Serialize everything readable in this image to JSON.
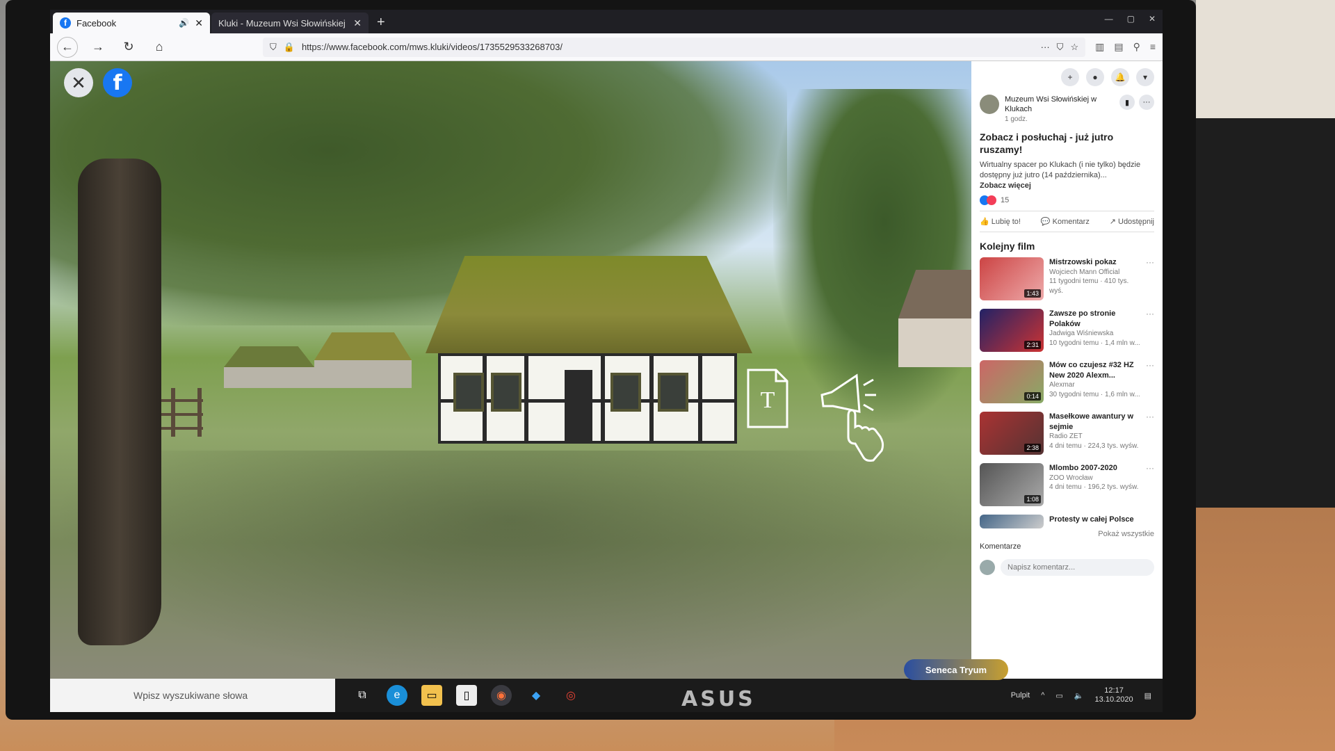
{
  "browser": {
    "tabs": [
      {
        "title": "Facebook",
        "active": true,
        "audio": true
      },
      {
        "title": "Kluki - Muzeum Wsi Słowińskiej w",
        "active": false
      }
    ],
    "url": "https://www.facebook.com/mws.kluki/videos/1735529533268703/"
  },
  "video": {
    "overlay_text_icon": "T"
  },
  "post": {
    "author": "Muzeum Wsi Słowińskiej w Klukach",
    "time": "1 godz.",
    "title": "Zobacz i posłuchaj - już jutro ruszamy!",
    "description": "Wirtualny spacer po Klukach (i nie tylko) będzie dostępny już jutro (14 października)...",
    "see_more": "Zobacz więcej",
    "reactions_count": "15",
    "actions": {
      "like": "Lubię to!",
      "comment": "Komentarz",
      "share": "Udostępnij"
    }
  },
  "next_videos": {
    "heading": "Kolejny film",
    "items": [
      {
        "title": "Mistrzowski pokaz",
        "channel": "Wojciech Mann Official",
        "meta": "11 tygodni temu · 410 tys. wyś.",
        "duration": "1:43"
      },
      {
        "title": "Zawsze po stronie Polaków",
        "channel": "Jadwiga Wiśniewska",
        "meta": "10 tygodni temu · 1,4 mln w...",
        "duration": "2:31"
      },
      {
        "title": "Mów co czujesz #32 HZ New 2020 Alexm...",
        "channel": "Alexmar",
        "meta": "30 tygodni temu · 1,6 mln w...",
        "duration": "0:14"
      },
      {
        "title": "Masełkowe awantury w sejmie",
        "channel": "Radio ZET",
        "meta": "4 dni temu · 224,3 tys. wyśw.",
        "duration": "2:38"
      },
      {
        "title": "Mlombo 2007-2020",
        "channel": "ZOO Wrocław",
        "meta": "4 dni temu · 196,2 tys. wyśw.",
        "duration": "1:08"
      },
      {
        "title": "Protesty w całej Polsce",
        "channel": "",
        "meta": "",
        "duration": ""
      }
    ],
    "show_all": "Pokaż wszystkie"
  },
  "comments": {
    "label": "Komentarze",
    "placeholder": "Napisz komentarz..."
  },
  "taskbar": {
    "search_text": "Wpisz wyszukiwane słowa",
    "desktop_label": "Pulpit",
    "time": "12:17",
    "date": "13.10.2020"
  },
  "monitor": {
    "brand": "ASUS",
    "sticker": "Seneca Tryum"
  },
  "colors": {
    "facebook_blue": "#1877f2",
    "browser_dark": "#1f1f24",
    "taskbar": "#1b1b1b"
  }
}
